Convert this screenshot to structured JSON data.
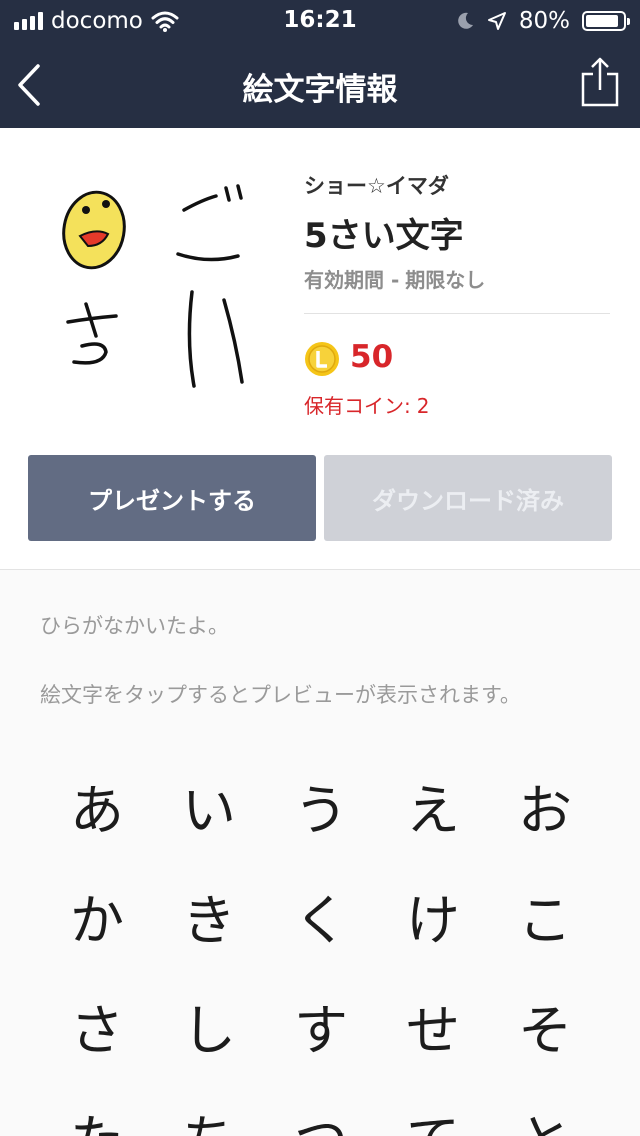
{
  "status_bar": {
    "carrier": "docomo",
    "time": "16:21",
    "battery": "80%"
  },
  "nav": {
    "title": "絵文字情報",
    "back_icon": "chevron-left-icon",
    "share_icon": "share-icon"
  },
  "product": {
    "author": "ショー☆イマダ",
    "name": "5さい文字",
    "validity_label": "有効期間 -",
    "validity_value": "期限なし",
    "coin_icon": "line-coin-icon",
    "price": "50",
    "owned_label": "保有コイン:",
    "owned_value": "2"
  },
  "buttons": {
    "present": "プレゼントする",
    "downloaded": "ダウンロード済み"
  },
  "description": "ひらがなかいたよ。",
  "hint": "絵文字をタップするとプレビューが表示されます。",
  "emoji_grid": [
    [
      "あ",
      "い",
      "う",
      "え",
      "お"
    ],
    [
      "か",
      "き",
      "く",
      "け",
      "こ"
    ],
    [
      "さ",
      "し",
      "す",
      "せ",
      "そ"
    ],
    [
      "た",
      "ち",
      "つ",
      "て",
      "と"
    ]
  ],
  "colors": {
    "header_bg": "#262f43",
    "present_button": "#626c83",
    "downloaded_button": "#cfd1d7",
    "price_red": "#d8262a",
    "coin_gold": "#f5c518"
  }
}
